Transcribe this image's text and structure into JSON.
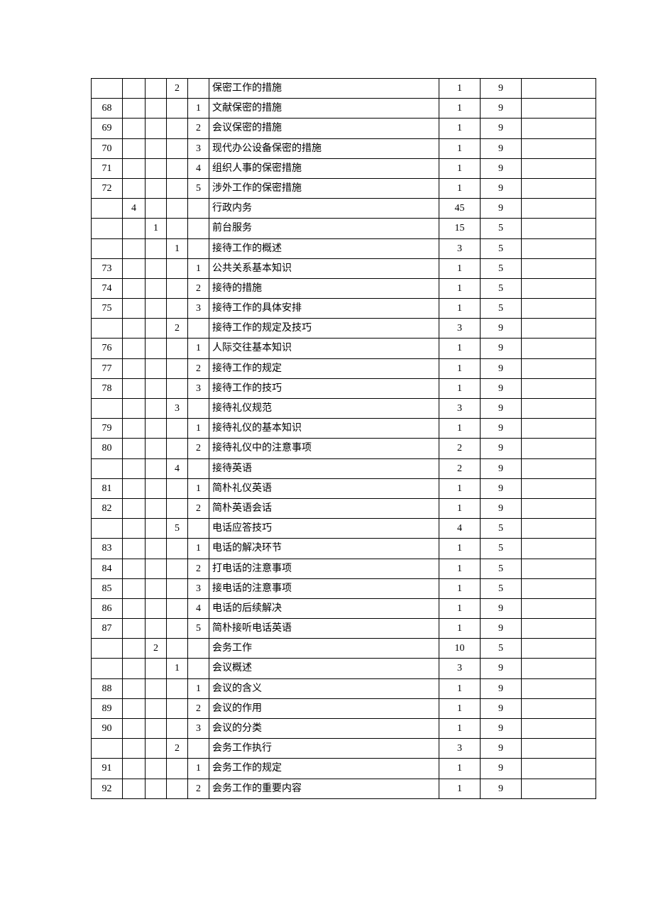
{
  "rows": [
    {
      "c1": "",
      "c2": "",
      "c3": "",
      "c4": "2",
      "c5": "",
      "c6": "保密工作的措施",
      "c7": "1",
      "c8": "9",
      "c9": ""
    },
    {
      "c1": "68",
      "c2": "",
      "c3": "",
      "c4": "",
      "c5": "1",
      "c6": "文献保密的措施",
      "c7": "1",
      "c8": "9",
      "c9": ""
    },
    {
      "c1": "69",
      "c2": "",
      "c3": "",
      "c4": "",
      "c5": "2",
      "c6": "会议保密的措施",
      "c7": "1",
      "c8": "9",
      "c9": ""
    },
    {
      "c1": "70",
      "c2": "",
      "c3": "",
      "c4": "",
      "c5": "3",
      "c6": "现代办公设备保密的措施",
      "c7": "1",
      "c8": "9",
      "c9": ""
    },
    {
      "c1": "71",
      "c2": "",
      "c3": "",
      "c4": "",
      "c5": "4",
      "c6": "组织人事的保密措施",
      "c7": "1",
      "c8": "9",
      "c9": ""
    },
    {
      "c1": "72",
      "c2": "",
      "c3": "",
      "c4": "",
      "c5": "5",
      "c6": "涉外工作的保密措施",
      "c7": "1",
      "c8": "9",
      "c9": ""
    },
    {
      "c1": "",
      "c2": "4",
      "c3": "",
      "c4": "",
      "c5": "",
      "c6": "行政内务",
      "c7": "45",
      "c8": "9",
      "c9": ""
    },
    {
      "c1": "",
      "c2": "",
      "c3": "1",
      "c4": "",
      "c5": "",
      "c6": "前台服务",
      "c7": "15",
      "c8": "5",
      "c9": ""
    },
    {
      "c1": "",
      "c2": "",
      "c3": "",
      "c4": "1",
      "c5": "",
      "c6": "接待工作的概述",
      "c7": "3",
      "c8": "5",
      "c9": ""
    },
    {
      "c1": "73",
      "c2": "",
      "c3": "",
      "c4": "",
      "c5": "1",
      "c6": "公共关系基本知识",
      "c7": "1",
      "c8": "5",
      "c9": ""
    },
    {
      "c1": "74",
      "c2": "",
      "c3": "",
      "c4": "",
      "c5": "2",
      "c6": "接待的措施",
      "c7": "1",
      "c8": "5",
      "c9": ""
    },
    {
      "c1": "75",
      "c2": "",
      "c3": "",
      "c4": "",
      "c5": "3",
      "c6": "接待工作的具体安排",
      "c7": "1",
      "c8": "5",
      "c9": ""
    },
    {
      "c1": "",
      "c2": "",
      "c3": "",
      "c4": "2",
      "c5": "",
      "c6": "接待工作的规定及技巧",
      "c7": "3",
      "c8": "9",
      "c9": ""
    },
    {
      "c1": "76",
      "c2": "",
      "c3": "",
      "c4": "",
      "c5": "1",
      "c6": "人际交往基本知识",
      "c7": "1",
      "c8": "9",
      "c9": ""
    },
    {
      "c1": "77",
      "c2": "",
      "c3": "",
      "c4": "",
      "c5": "2",
      "c6": "接待工作的规定",
      "c7": "1",
      "c8": "9",
      "c9": ""
    },
    {
      "c1": "78",
      "c2": "",
      "c3": "",
      "c4": "",
      "c5": "3",
      "c6": "接待工作的技巧",
      "c7": "1",
      "c8": "9",
      "c9": ""
    },
    {
      "c1": "",
      "c2": "",
      "c3": "",
      "c4": "3",
      "c5": "",
      "c6": "接待礼仪规范",
      "c7": "3",
      "c8": "9",
      "c9": ""
    },
    {
      "c1": "79",
      "c2": "",
      "c3": "",
      "c4": "",
      "c5": "1",
      "c6": "接待礼仪的基本知识",
      "c7": "1",
      "c8": "9",
      "c9": ""
    },
    {
      "c1": "80",
      "c2": "",
      "c3": "",
      "c4": "",
      "c5": "2",
      "c6": "接待礼仪中的注意事项",
      "c7": "2",
      "c8": "9",
      "c9": ""
    },
    {
      "c1": "",
      "c2": "",
      "c3": "",
      "c4": "4",
      "c5": "",
      "c6": "接待英语",
      "c7": "2",
      "c8": "9",
      "c9": ""
    },
    {
      "c1": "81",
      "c2": "",
      "c3": "",
      "c4": "",
      "c5": "1",
      "c6": "简朴礼仪英语",
      "c7": "1",
      "c8": "9",
      "c9": ""
    },
    {
      "c1": "82",
      "c2": "",
      "c3": "",
      "c4": "",
      "c5": "2",
      "c6": "简朴英语会话",
      "c7": "1",
      "c8": "9",
      "c9": ""
    },
    {
      "c1": "",
      "c2": "",
      "c3": "",
      "c4": "5",
      "c5": "",
      "c6": "电话应答技巧",
      "c7": "4",
      "c8": "5",
      "c9": ""
    },
    {
      "c1": "83",
      "c2": "",
      "c3": "",
      "c4": "",
      "c5": "1",
      "c6": "电话的解决环节",
      "c7": "1",
      "c8": "5",
      "c9": ""
    },
    {
      "c1": "84",
      "c2": "",
      "c3": "",
      "c4": "",
      "c5": "2",
      "c6": "打电话的注意事项",
      "c7": "1",
      "c8": "5",
      "c9": ""
    },
    {
      "c1": "85",
      "c2": "",
      "c3": "",
      "c4": "",
      "c5": "3",
      "c6": "接电话的注意事项",
      "c7": "1",
      "c8": "5",
      "c9": ""
    },
    {
      "c1": "86",
      "c2": "",
      "c3": "",
      "c4": "",
      "c5": "4",
      "c6": "电话的后续解决",
      "c7": "1",
      "c8": "9",
      "c9": ""
    },
    {
      "c1": "87",
      "c2": "",
      "c3": "",
      "c4": "",
      "c5": "5",
      "c6": "简朴接听电话英语",
      "c7": "1",
      "c8": "9",
      "c9": ""
    },
    {
      "c1": "",
      "c2": "",
      "c3": "2",
      "c4": "",
      "c5": "",
      "c6": "会务工作",
      "c7": "10",
      "c8": "5",
      "c9": ""
    },
    {
      "c1": "",
      "c2": "",
      "c3": "",
      "c4": "1",
      "c5": "",
      "c6": "会议概述",
      "c7": "3",
      "c8": "9",
      "c9": ""
    },
    {
      "c1": "88",
      "c2": "",
      "c3": "",
      "c4": "",
      "c5": "1",
      "c6": "会议的含义",
      "c7": "1",
      "c8": "9",
      "c9": ""
    },
    {
      "c1": "89",
      "c2": "",
      "c3": "",
      "c4": "",
      "c5": "2",
      "c6": "会议的作用",
      "c7": "1",
      "c8": "9",
      "c9": ""
    },
    {
      "c1": "90",
      "c2": "",
      "c3": "",
      "c4": "",
      "c5": "3",
      "c6": "会议的分类",
      "c7": "1",
      "c8": "9",
      "c9": ""
    },
    {
      "c1": "",
      "c2": "",
      "c3": "",
      "c4": "2",
      "c5": "",
      "c6": "会务工作执行",
      "c7": "3",
      "c8": "9",
      "c9": ""
    },
    {
      "c1": "91",
      "c2": "",
      "c3": "",
      "c4": "",
      "c5": "1",
      "c6": "会务工作的规定",
      "c7": "1",
      "c8": "9",
      "c9": ""
    },
    {
      "c1": "92",
      "c2": "",
      "c3": "",
      "c4": "",
      "c5": "2",
      "c6": "会务工作的重要内容",
      "c7": "1",
      "c8": "9",
      "c9": ""
    }
  ]
}
